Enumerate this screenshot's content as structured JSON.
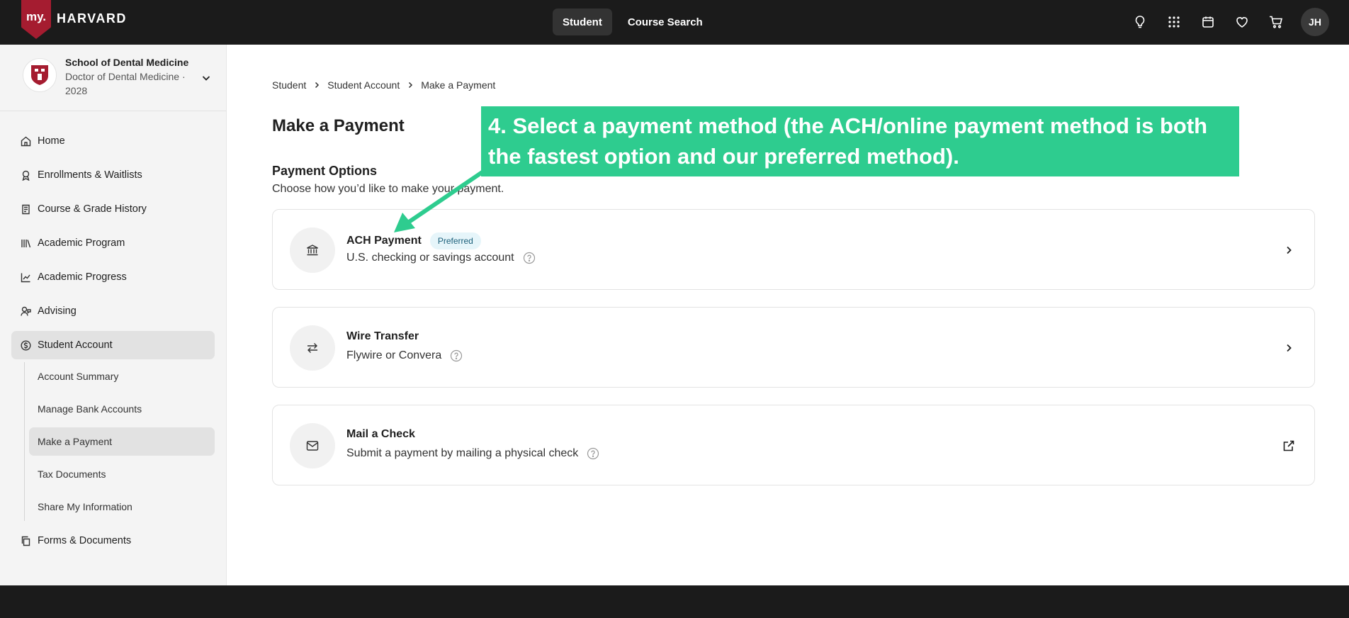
{
  "app": {
    "logo_prefix": "my.",
    "logo_word": "HARVARD"
  },
  "topnav": {
    "items": [
      {
        "label": "Student",
        "active": true
      },
      {
        "label": "Course Search",
        "active": false
      }
    ]
  },
  "top_icons": [
    "lightbulb-icon",
    "apps-grid-icon",
    "calendar-icon",
    "heart-icon",
    "cart-icon"
  ],
  "user": {
    "initials": "JH"
  },
  "school": {
    "name": "School of Dental Medicine",
    "program": "Doctor of Dental Medicine · 2028"
  },
  "sidebar": {
    "items": [
      {
        "label": "Home",
        "icon": "home-icon"
      },
      {
        "label": "Enrollments & Waitlists",
        "icon": "ribbon-icon"
      },
      {
        "label": "Course & Grade History",
        "icon": "scroll-icon"
      },
      {
        "label": "Academic Program",
        "icon": "books-icon"
      },
      {
        "label": "Academic Progress",
        "icon": "chart-line-icon"
      },
      {
        "label": "Advising",
        "icon": "person-chat-icon"
      },
      {
        "label": "Student Account",
        "icon": "dollar-circle-icon"
      },
      {
        "label": "Forms & Documents",
        "icon": "documents-icon"
      }
    ],
    "sub_items": [
      {
        "label": "Account Summary"
      },
      {
        "label": "Manage Bank Accounts"
      },
      {
        "label": "Make a Payment"
      },
      {
        "label": "Tax Documents"
      },
      {
        "label": "Share My Information"
      }
    ]
  },
  "breadcrumb": [
    "Student",
    "Student Account",
    "Make a Payment"
  ],
  "page": {
    "title": "Make a Payment",
    "section_title": "Payment Options",
    "section_desc": "Choose how you’d like to make your payment."
  },
  "payment_options": [
    {
      "title": "ACH Payment",
      "badge": "Preferred",
      "subtitle": "U.S. checking or savings account",
      "icon": "bank-icon",
      "action_icon": "chevron-right-icon"
    },
    {
      "title": "Wire Transfer",
      "subtitle": "Flywire or Convera",
      "icon": "transfer-arrows-icon",
      "action_icon": "chevron-right-icon"
    },
    {
      "title": "Mail a Check",
      "subtitle": "Submit a payment by mailing a physical check",
      "icon": "envelope-icon",
      "action_icon": "external-link-icon"
    }
  ],
  "annotation": {
    "text": "4. Select a payment method (the ACH/online payment method is both the fastest option and our preferred method).",
    "color": "#2ecc8f"
  },
  "colors": {
    "brand_crimson": "#a51c30",
    "topbar": "#1b1b1b",
    "badge_bg": "#e6f5fa"
  }
}
